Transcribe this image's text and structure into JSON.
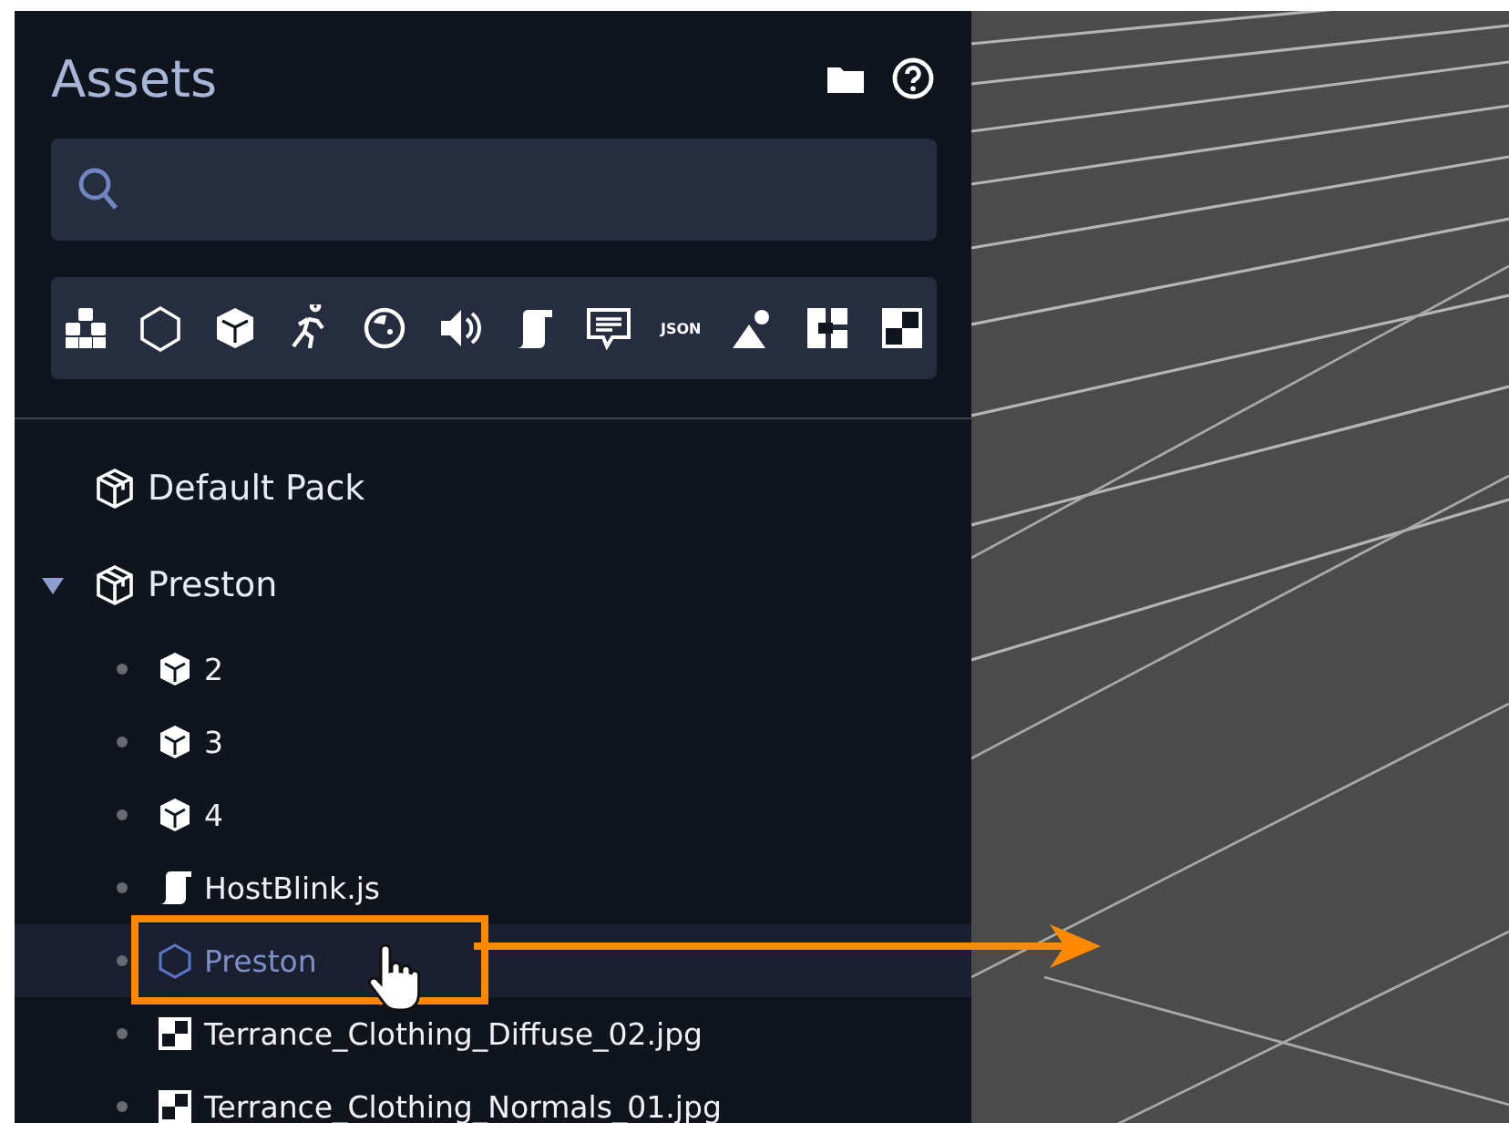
{
  "panel": {
    "title": "Assets"
  },
  "filters": [
    {
      "kind": "entity"
    },
    {
      "kind": "template"
    },
    {
      "kind": "model"
    },
    {
      "kind": "animation"
    },
    {
      "kind": "material"
    },
    {
      "kind": "audio"
    },
    {
      "kind": "script"
    },
    {
      "kind": "text"
    },
    {
      "kind": "json",
      "label": "JSON"
    },
    {
      "kind": "sprite"
    },
    {
      "kind": "atlas"
    },
    {
      "kind": "texture"
    }
  ],
  "tree": [
    {
      "label": "Default Pack",
      "kind": "pack"
    },
    {
      "label": "Preston",
      "kind": "pack",
      "expanded": true,
      "children": [
        {
          "label": "2",
          "kind": "model",
          "selected": false
        },
        {
          "label": "3",
          "kind": "model",
          "selected": false
        },
        {
          "label": "4",
          "kind": "model",
          "selected": false
        },
        {
          "label": "HostBlink.js",
          "kind": "script",
          "selected": false
        },
        {
          "label": "Preston",
          "kind": "template",
          "selected": true
        },
        {
          "label": "Terrance_Clothing_Diffuse_02.jpg",
          "kind": "texture",
          "selected": false
        },
        {
          "label": "Terrance_Clothing_Normals_01.jpg",
          "kind": "texture",
          "selected": false
        }
      ]
    }
  ]
}
